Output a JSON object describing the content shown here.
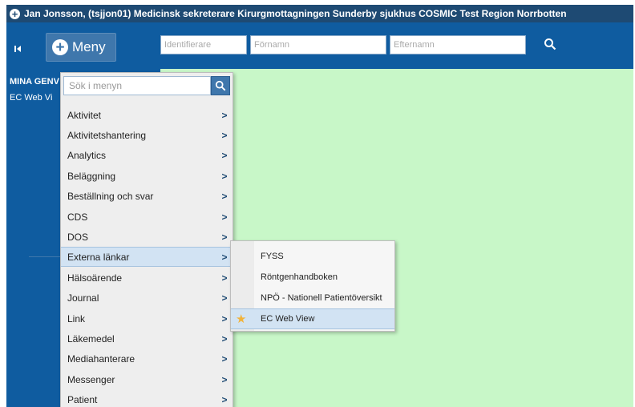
{
  "title_bar": {
    "text": "Jan  Jonsson, (tsjjon01) Medicinsk sekreterare Kirurgmottagningen Sunderby sjukhus COSMIC Test Region Norrbotten"
  },
  "toolbar": {
    "menu_label": "Meny",
    "identifier_placeholder": "Identifierare",
    "firstname_placeholder": "Förnamn",
    "lastname_placeholder": "Efternamn"
  },
  "sidebar": {
    "heading": "MINA GENV",
    "link": "EC Web Vi"
  },
  "dropdown": {
    "search_placeholder": "Sök i menyn",
    "items": [
      {
        "label": "Aktivitet"
      },
      {
        "label": "Aktivitetshantering"
      },
      {
        "label": "Analytics"
      },
      {
        "label": "Beläggning"
      },
      {
        "label": "Beställning och svar"
      },
      {
        "label": "CDS"
      },
      {
        "label": "DOS"
      },
      {
        "label": "Externa länkar"
      },
      {
        "label": "Hälsoärende"
      },
      {
        "label": "Journal"
      },
      {
        "label": "Link"
      },
      {
        "label": "Läkemedel"
      },
      {
        "label": "Mediahanterare"
      },
      {
        "label": "Messenger"
      },
      {
        "label": "Patient"
      }
    ],
    "active_item": "Externa länkar"
  },
  "submenu": {
    "items": [
      {
        "label": "FYSS"
      },
      {
        "label": "Röntgenhandboken"
      },
      {
        "label": "NPÖ - Nationell Patientöversikt"
      },
      {
        "label": "EC Web View",
        "favorite": true
      }
    ]
  },
  "colors": {
    "header": "#1e4a73",
    "toolbar": "#0f5ca0",
    "workspace": "#c8f7c8",
    "highlight": "#d2e3f3",
    "star": "#f2b33a"
  }
}
